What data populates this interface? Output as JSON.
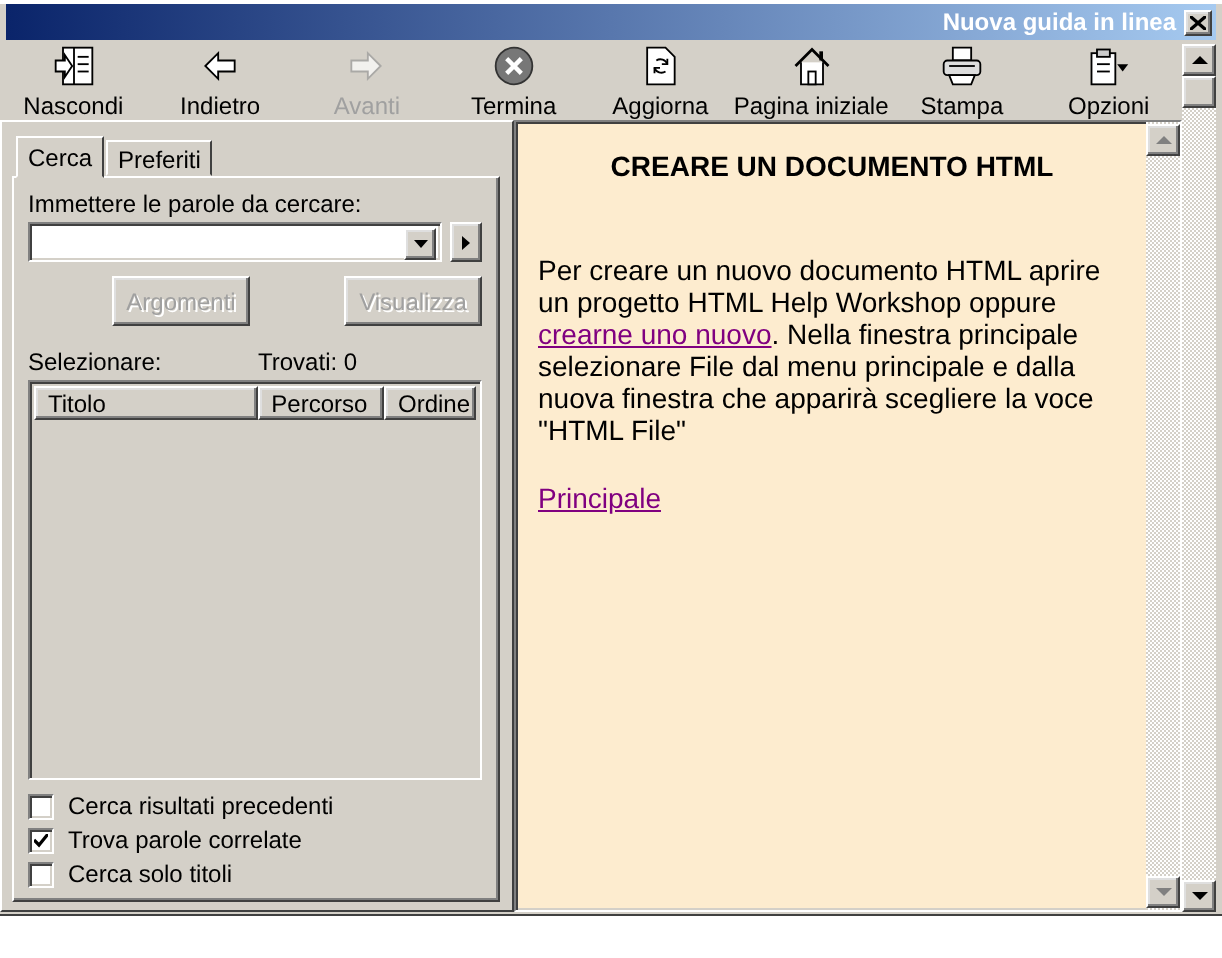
{
  "window": {
    "title": "Nuova guida in linea"
  },
  "toolbar": [
    {
      "label": "Nascondi",
      "kind": "hide",
      "disabled": false
    },
    {
      "label": "Indietro",
      "kind": "back",
      "disabled": false
    },
    {
      "label": "Avanti",
      "kind": "forward",
      "disabled": true
    },
    {
      "label": "Termina",
      "kind": "stop",
      "disabled": false
    },
    {
      "label": "Aggiorna",
      "kind": "refresh",
      "disabled": false
    },
    {
      "label": "Pagina iniziale",
      "kind": "home",
      "disabled": false
    },
    {
      "label": "Stampa",
      "kind": "print",
      "disabled": false
    },
    {
      "label": "Opzioni",
      "kind": "options",
      "disabled": false
    }
  ],
  "tabs": [
    {
      "label": "Cerca",
      "selected": true
    },
    {
      "label": "Preferiti",
      "selected": false
    }
  ],
  "search": {
    "label": "Immettere le parole da cercare:"
  },
  "buttons": [
    {
      "label": "Argomenti",
      "disabled": true
    },
    {
      "label": "Visualizza",
      "disabled": true
    }
  ],
  "results": {
    "select_label": "Selezionare:",
    "found": "Trovati: 0",
    "columns": [
      "Titolo",
      "Percorso",
      "Ordine"
    ]
  },
  "options": [
    {
      "label": "Cerca risultati precedenti",
      "checked": false
    },
    {
      "label": "Trova parole correlate",
      "checked": true
    },
    {
      "label": "Cerca solo titoli",
      "checked": false
    }
  ],
  "content": {
    "heading": "CREARE UN DOCUMENTO HTML",
    "text_before": "Per creare un nuovo documento HTML aprire un progetto HTML Help Workshop oppure",
    "link": "crearne uno nuovo",
    "text_after": ". Nella finestra principale selezionare File dal menu principale e dalla nuova finestra che apparirà scegliere la voce \"HTML File\"",
    "bottom_link": "Principale"
  }
}
